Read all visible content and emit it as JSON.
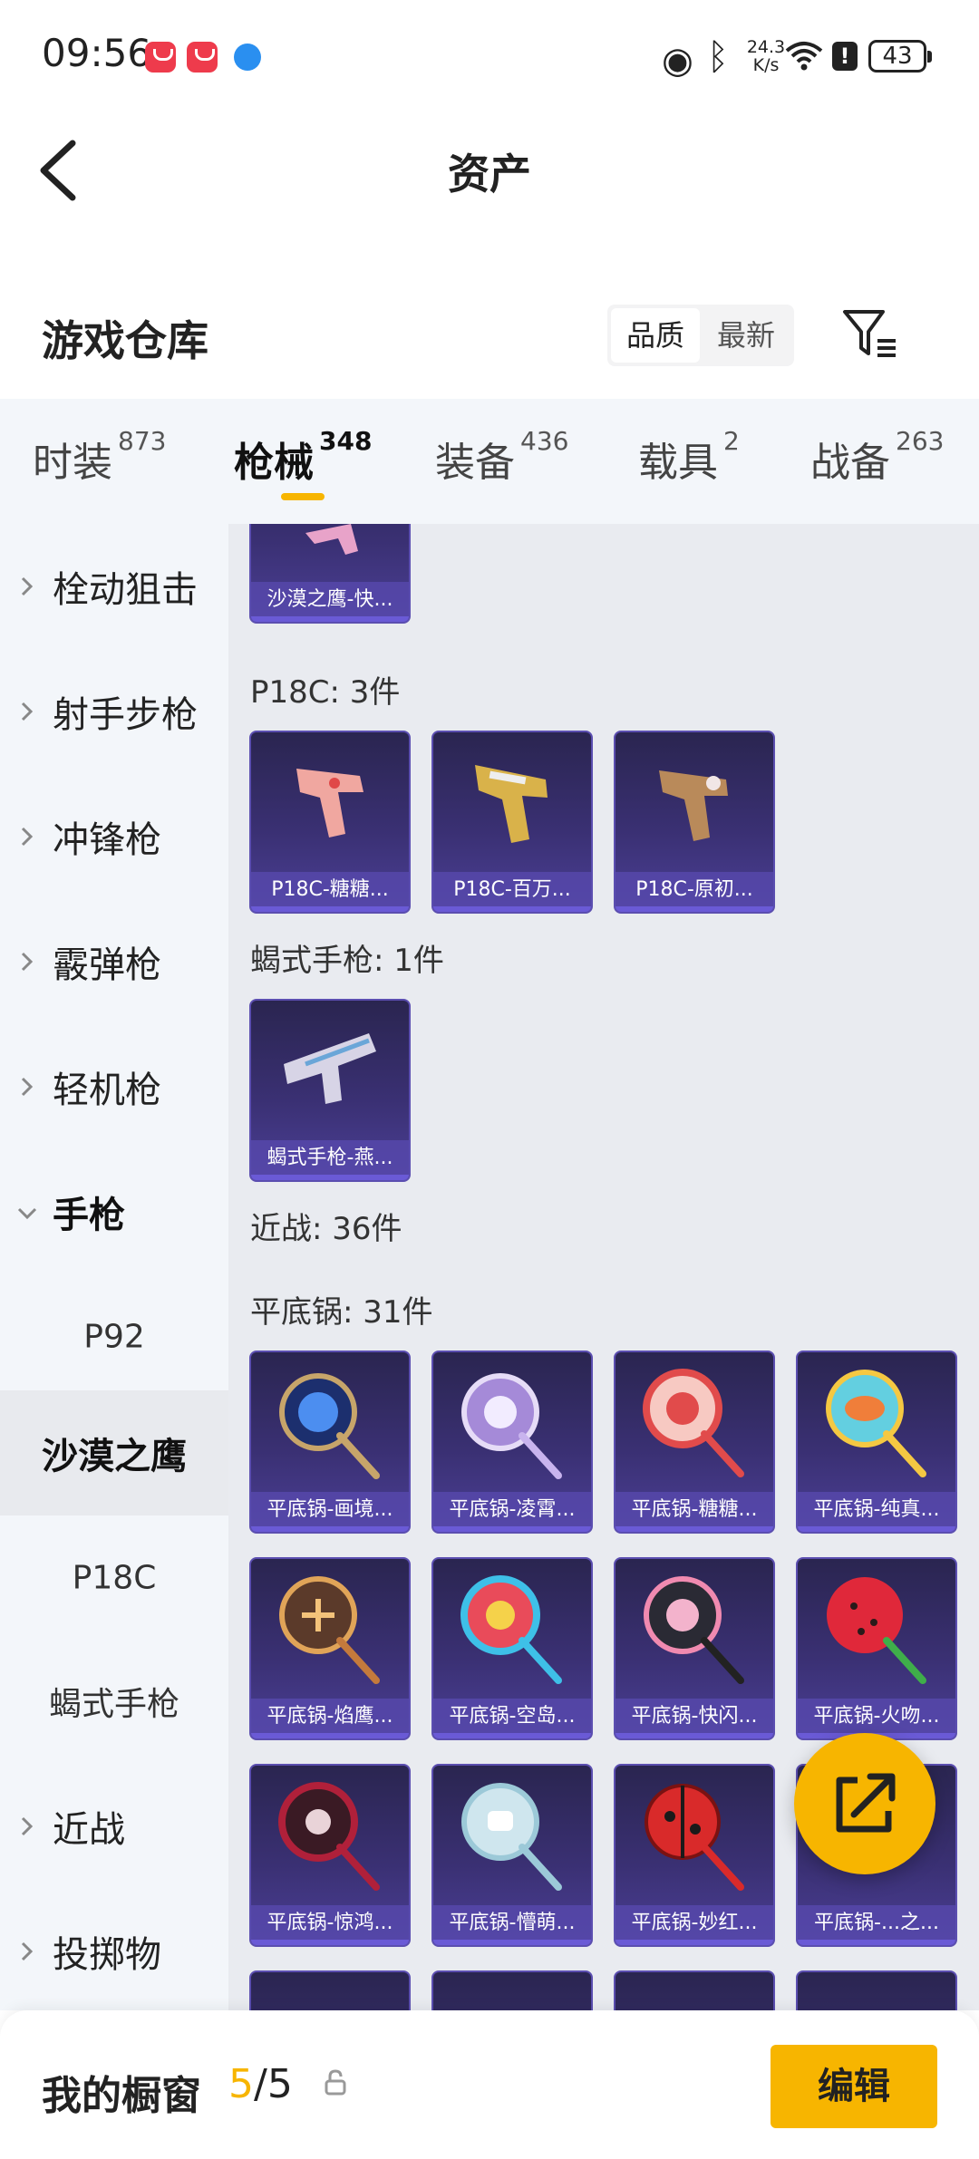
{
  "status_bar": {
    "time": "09:56",
    "net_speed_value": "24.3",
    "net_speed_unit": "K/s",
    "battery": "43"
  },
  "header": {
    "title": "资产"
  },
  "warehouse": {
    "title": "游戏仓库",
    "sort_options": [
      "品质",
      "最新"
    ],
    "selected_sort": "品质"
  },
  "tabs": [
    {
      "label": "时装",
      "count": "873"
    },
    {
      "label": "枪械",
      "count": "348",
      "active": true
    },
    {
      "label": "装备",
      "count": "436"
    },
    {
      "label": "载具",
      "count": "2"
    },
    {
      "label": "战备",
      "count": "263"
    }
  ],
  "sidebar": {
    "items": [
      {
        "label": "栓动狙击"
      },
      {
        "label": "射手步枪"
      },
      {
        "label": "冲锋枪"
      },
      {
        "label": "霰弹枪"
      },
      {
        "label": "轻机枪"
      },
      {
        "label": "手枪",
        "expanded": true
      },
      {
        "label": "P92"
      },
      {
        "label": "沙漠之鹰",
        "selected": true
      },
      {
        "label": "P18C"
      },
      {
        "label": "蝎式手枪"
      },
      {
        "label": "近战"
      },
      {
        "label": "投掷物"
      }
    ]
  },
  "content": {
    "top_card": "沙漠之鹰-快...",
    "groups": [
      {
        "label": "P18C: 3件",
        "items": [
          "P18C-糖糖...",
          "P18C-百万...",
          "P18C-原初..."
        ]
      },
      {
        "label": "蝎式手枪: 1件",
        "items": [
          "蝎式手枪-燕..."
        ]
      },
      {
        "label": "近战: 36件"
      },
      {
        "label": "平底锅: 31件",
        "items": [
          "平底锅-画境...",
          "平底锅-凌霄...",
          "平底锅-糖糖...",
          "平底锅-纯真...",
          "平底锅-焰鹰...",
          "平底锅-空岛...",
          "平底锅-快闪...",
          "平底锅-火吻...",
          "平底锅-惊鸿...",
          "平底锅-懵萌...",
          "平底锅-妙红...",
          "平底锅-...之..."
        ]
      }
    ]
  },
  "bottom_bar": {
    "label": "我的橱窗",
    "current": "5",
    "total": "/5",
    "edit_label": "编辑"
  },
  "colors": {
    "accent": "#f7b500",
    "card_bg": "#3a3073"
  }
}
